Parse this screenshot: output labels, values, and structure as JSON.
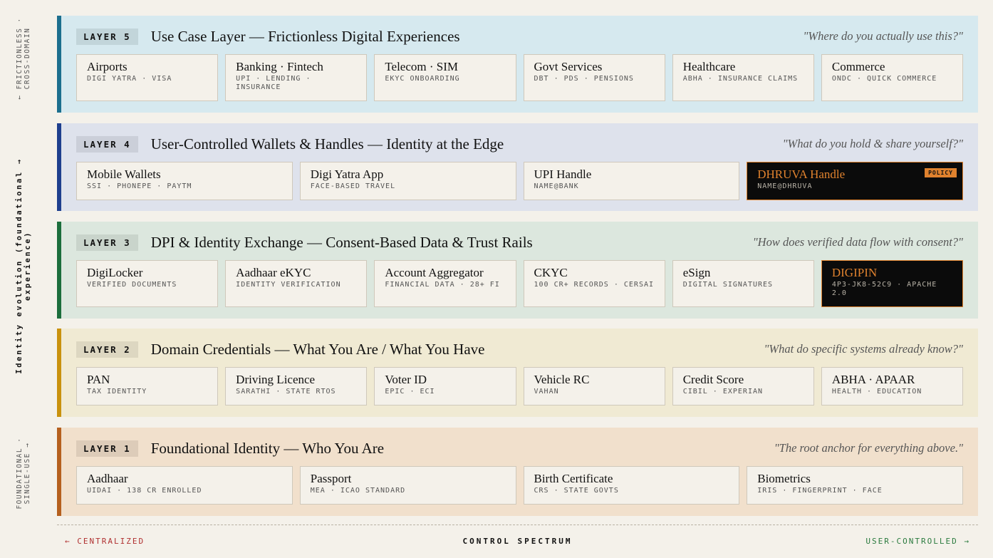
{
  "side": {
    "bottom": [
      "Foundational ·",
      "single-use →"
    ],
    "main": [
      "Identity evolution (foundational →",
      "experience)"
    ],
    "top": [
      "← frictionless ·",
      "cross-domain"
    ]
  },
  "layers": {
    "l5": {
      "tag": "LAYER 5",
      "title": "Use Case Layer — Frictionless Digital Experiences",
      "question": "\"Where do you actually use this?\"",
      "cards": [
        {
          "title": "Airports",
          "sub": "DIGI YATRA · VISA"
        },
        {
          "title": "Banking · Fintech",
          "sub": "UPI · LENDING · INSURANCE"
        },
        {
          "title": "Telecom · SIM",
          "sub": "EKYC ONBOARDING"
        },
        {
          "title": "Govt Services",
          "sub": "DBT · PDS · PENSIONS"
        },
        {
          "title": "Healthcare",
          "sub": "ABHA · INSURANCE CLAIMS"
        },
        {
          "title": "Commerce",
          "sub": "ONDC · QUICK COMMERCE"
        }
      ]
    },
    "l4": {
      "tag": "LAYER 4",
      "title": "User-Controlled Wallets & Handles — Identity at the Edge",
      "question": "\"What do you hold & share yourself?\"",
      "cards": [
        {
          "title": "Mobile Wallets",
          "sub": "SSI · PHONEPE · PAYTM"
        },
        {
          "title": "Digi Yatra App",
          "sub": "FACE-BASED TRAVEL"
        },
        {
          "title": "UPI Handle",
          "sub": "NAME@BANK"
        },
        {
          "title": "DHRUVA Handle",
          "sub": "NAME@DHRUVA",
          "badge": "POLICY"
        }
      ]
    },
    "l3": {
      "tag": "LAYER 3",
      "title": "DPI & Identity Exchange — Consent-Based Data & Trust Rails",
      "question": "\"How does verified data flow with consent?\"",
      "cards": [
        {
          "title": "DigiLocker",
          "sub": "VERIFIED DOCUMENTS"
        },
        {
          "title": "Aadhaar eKYC",
          "sub": "IDENTITY VERIFICATION"
        },
        {
          "title": "Account Aggregator",
          "sub": "FINANCIAL DATA · 28+ FI"
        },
        {
          "title": "CKYC",
          "sub": "100 CR+ RECORDS · CERSAI"
        },
        {
          "title": "eSign",
          "sub": "DIGITAL SIGNATURES"
        },
        {
          "title": "DIGIPIN",
          "sub": "4P3-JK8-52C9 · APACHE 2.0"
        }
      ]
    },
    "l2": {
      "tag": "LAYER 2",
      "title": "Domain Credentials — What You Are / What You Have",
      "question": "\"What do specific systems already know?\"",
      "cards": [
        {
          "title": "PAN",
          "sub": "TAX IDENTITY"
        },
        {
          "title": "Driving Licence",
          "sub": "SARATHI · STATE RTOS"
        },
        {
          "title": "Voter ID",
          "sub": "EPIC · ECI"
        },
        {
          "title": "Vehicle RC",
          "sub": "VAHAN"
        },
        {
          "title": "Credit Score",
          "sub": "CIBIL · EXPERIAN"
        },
        {
          "title": "ABHA · APAAR",
          "sub": "HEALTH · EDUCATION"
        }
      ]
    },
    "l1": {
      "tag": "LAYER 1",
      "title": "Foundational Identity — Who You Are",
      "question": "\"The root anchor for everything above.\"",
      "cards": [
        {
          "title": "Aadhaar",
          "sub": "UIDAI · 138 CR ENROLLED"
        },
        {
          "title": "Passport",
          "sub": "MEA · ICAO STANDARD"
        },
        {
          "title": "Birth Certificate",
          "sub": "CRS · STATE GOVTS"
        },
        {
          "title": "Biometrics",
          "sub": "IRIS · FINGERPRINT · FACE"
        }
      ]
    }
  },
  "spectrum": {
    "left": "← CENTRALIZED",
    "center": "CONTROL SPECTRUM",
    "right": "USER-CONTROLLED →"
  }
}
